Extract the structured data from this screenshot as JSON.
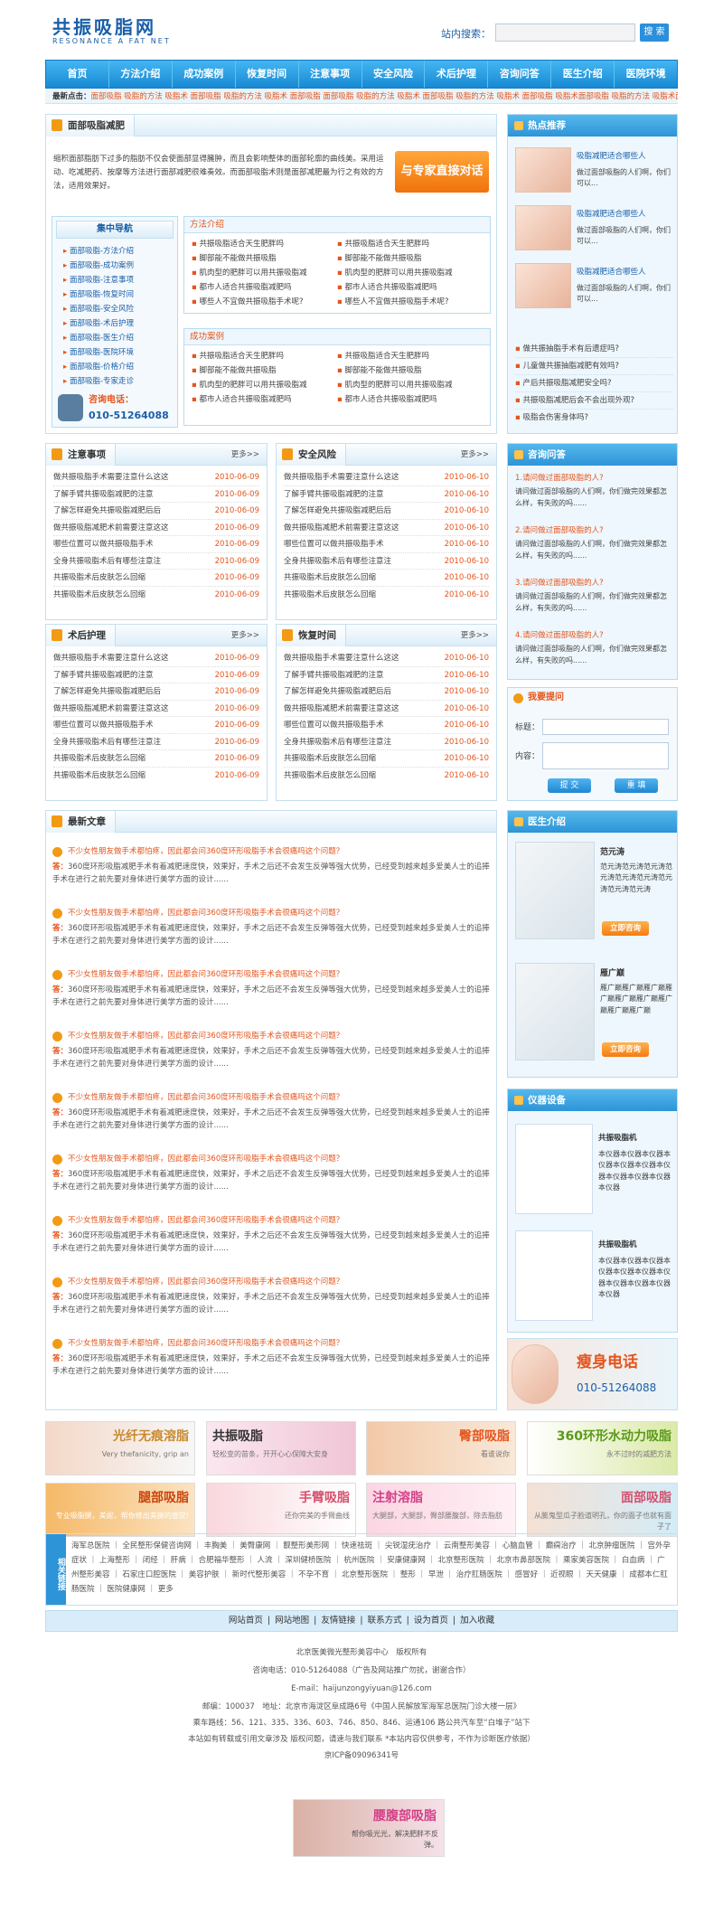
{
  "header": {
    "logo": "共振吸脂网",
    "logo_en": "RESONANCE A FAT NET",
    "search_label": "站内搜索：",
    "search_button": "搜 索"
  },
  "nav": [
    "首页",
    "方法介绍",
    "成功案例",
    "恢复时间",
    "注意事项",
    "安全风险",
    "术后护理",
    "咨询问答",
    "医生介绍",
    "医院环境"
  ],
  "hot": {
    "label": "最新点击：",
    "text": "面部吸脂 吸脂的方法 吸脂术 面部吸脂 吸脂的方法 吸脂术 面部吸脂 面部吸脂 吸脂的方法 吸脂术 面部吸脂 吸脂的方法 吸脂术 面部吸脂 吸脂术面部吸脂 吸脂的方法 吸脂术面部吸脂"
  },
  "intro": {
    "title": "面部吸脂减肥",
    "text": "缩积面部脂肪下过多的脂肪不仅会使面部显得臃肿，而且会影响整体的面部轮廓的曲线美。采用运动、吃减肥药、按摩等方法进行面部减肥很难奏效。而面部吸脂术则是面部减肥最为行之有效的方法，适用效果好。",
    "expert": "与专家直接对话"
  },
  "guide": {
    "title": "集中导航",
    "items": [
      "面部吸脂-方法介绍",
      "面部吸脂-成功案例",
      "面部吸脂-注意事项",
      "面部吸脂-恢复时间",
      "面部吸脂-安全风险",
      "面部吸脂-术后护理",
      "面部吸脂-医生介绍",
      "面部吸脂-医院环境",
      "面部吸脂-价格介绍",
      "面部吸脂-专家走诊"
    ],
    "phone_label": "咨询电话：",
    "phone": "010-51264088"
  },
  "methods": {
    "title": "方法介绍",
    "items": [
      "共振吸脂适合天生肥胖吗",
      "共振吸脂适合天生肥胖吗",
      "脚部能不能做共振吸脂",
      "脚部能不能做共振吸脂",
      "肌肉型的肥胖可以用共振吸脂减",
      "肌肉型的肥胖可以用共振吸脂减",
      "都市人适合共振吸脂减肥吗",
      "都市人适合共振吸脂减肥吗",
      "哪些人不宜做共振吸脂手术呢?",
      "哪些人不宜做共振吸脂手术呢?"
    ]
  },
  "cases": {
    "title": "成功案例",
    "items": [
      "共振吸脂适合天生肥胖吗",
      "共振吸脂适合天生肥胖吗",
      "脚部能不能做共振吸脂",
      "脚部能不能做共振吸脂",
      "肌肉型的肥胖可以用共振吸脂减",
      "肌肉型的肥胖可以用共振吸脂减",
      "都市人适合共振吸脂减肥吗",
      "都市人适合共振吸脂减肥吗"
    ]
  },
  "hot_recommend": {
    "title": "热点推荐",
    "items": [
      {
        "t": "吸脂减肥适合哪些人",
        "d": "做过面部吸脂的人们啊，你们可以..."
      },
      {
        "t": "吸脂减肥适合哪些人",
        "d": "做过面部吸脂的人们啊，你们可以..."
      },
      {
        "t": "吸脂减肥适合哪些人",
        "d": "做过面部吸脂的人们啊，你们可以..."
      }
    ],
    "links": [
      "做共振抽脂手术有后遗症吗?",
      "儿童做共振抽脂减肥有效吗?",
      "产后共振吸脂减肥安全吗?",
      "共振吸脂减肥后会不会出现外观?",
      "吸脂会伤害身体吗?"
    ]
  },
  "more": "更多>>",
  "notes": {
    "title": "注意事项",
    "items": [
      [
        "做共振吸脂手术需要注意什么这这",
        "2010-06-09"
      ],
      [
        "了解手臂共振吸脂减肥的注意",
        "2010-06-09"
      ],
      [
        "了解怎样避免共振吸脂减肥后后",
        "2010-06-09"
      ],
      [
        "做共振吸脂减肥术前需要注意这这",
        "2010-06-09"
      ],
      [
        "哪些位置可以做共振吸脂手术",
        "2010-06-09"
      ],
      [
        "全身共振吸脂术后有哪些注意注",
        "2010-06-09"
      ],
      [
        "共振吸脂术后皮肤怎么回缩",
        "2010-06-09"
      ],
      [
        "共振吸脂术后皮肤怎么回缩",
        "2010-06-09"
      ]
    ]
  },
  "safety": {
    "title": "安全风险",
    "items": [
      [
        "做共振吸脂手术需要注意什么这这",
        "2010-06-10"
      ],
      [
        "了解手臂共振吸脂减肥的注意",
        "2010-06-10"
      ],
      [
        "了解怎样避免共振吸脂减肥后后",
        "2010-06-10"
      ],
      [
        "做共振吸脂减肥术前需要注意这这",
        "2010-06-10"
      ],
      [
        "哪些位置可以做共振吸脂手术",
        "2010-06-10"
      ],
      [
        "全身共振吸脂术后有哪些注意注",
        "2010-06-10"
      ],
      [
        "共振吸脂术后皮肤怎么回缩",
        "2010-06-10"
      ],
      [
        "共振吸脂术后皮肤怎么回缩",
        "2010-06-10"
      ]
    ]
  },
  "aftercare": {
    "title": "术后护理",
    "items": [
      [
        "做共振吸脂手术需要注意什么这这",
        "2010-06-09"
      ],
      [
        "了解手臂共振吸脂减肥的注意",
        "2010-06-09"
      ],
      [
        "了解怎样避免共振吸脂减肥后后",
        "2010-06-09"
      ],
      [
        "做共振吸脂减肥术前需要注意这这",
        "2010-06-09"
      ],
      [
        "哪些位置可以做共振吸脂手术",
        "2010-06-09"
      ],
      [
        "全身共振吸脂术后有哪些注意注",
        "2010-06-09"
      ],
      [
        "共振吸脂术后皮肤怎么回缩",
        "2010-06-09"
      ],
      [
        "共振吸脂术后皮肤怎么回缩",
        "2010-06-09"
      ]
    ]
  },
  "recovery": {
    "title": "恢复时间",
    "items": [
      [
        "做共振吸脂手术需要注意什么这这",
        "2010-06-10"
      ],
      [
        "了解手臂共振吸脂减肥的注意",
        "2010-06-10"
      ],
      [
        "了解怎样避免共振吸脂减肥后后",
        "2010-06-10"
      ],
      [
        "做共振吸脂减肥术前需要注意这这",
        "2010-06-10"
      ],
      [
        "哪些位置可以做共振吸脂手术",
        "2010-06-10"
      ],
      [
        "全身共振吸脂术后有哪些注意注",
        "2010-06-10"
      ],
      [
        "共振吸脂术后皮肤怎么回缩",
        "2010-06-10"
      ],
      [
        "共振吸脂术后皮肤怎么回缩",
        "2010-06-10"
      ]
    ]
  },
  "consult": {
    "title": "咨询问答",
    "items": [
      {
        "q": "1.请问做过面部吸脂的人?",
        "a": "请问做过面部吸脂的人们啊，你们做完效果都怎么样，有失败的吗......"
      },
      {
        "q": "2.请问做过面部吸脂的人?",
        "a": "请问做过面部吸脂的人们啊，你们做完效果都怎么样，有失败的吗......"
      },
      {
        "q": "3.请问做过面部吸脂的人?",
        "a": "请问做过面部吸脂的人们啊，你们做完效果都怎么样，有失败的吗......"
      },
      {
        "q": "4.请问做过面部吸脂的人?",
        "a": "请问做过面部吸脂的人们啊，你们做完效果都怎么样，有失败的吗......"
      }
    ]
  },
  "ask": {
    "title": "我要提问",
    "label_title": "标题：",
    "label_content": "内容：",
    "submit": "提 交",
    "reset": "重 填"
  },
  "latest": {
    "title": "最新文章",
    "q": "不少女性朋友做手术都怕疼，因此都会问360度环形吸脂手术会很痛吗这个问题？",
    "a_label": "答：",
    "a": "360度环形吸脂减肥手术有着减肥速度快，效果好，手术之后还不会发生反弹等强大优势，已经受到越来越多爱美人士的追捧手术在进行之前先要对身体进行美学方面的设计......"
  },
  "doctors": {
    "title": "医生介绍",
    "items": [
      {
        "name": "范元涛",
        "text": "范元涛范元涛范元涛范元涛范元涛范元涛范元涛范元涛范元涛",
        "btn": "立即咨询"
      },
      {
        "name": "雁广巅",
        "text": "雁广巅雁广巅雁广巅雁广巅雁广巅雁广巅雁广巅雁广巅雁广巅",
        "btn": "立即咨询"
      }
    ]
  },
  "devices": {
    "title": "仪器设备",
    "items": [
      {
        "name": "共振吸脂机",
        "text": "本仪器本仪器本仪器本仪器本仪器本仪器本仪器本仪器本仪器本仪器本仪器"
      },
      {
        "name": "共振吸脂机",
        "text": "本仪器本仪器本仪器本仪器本仪器本仪器本仪器本仪器本仪器本仪器本仪器"
      }
    ]
  },
  "slim_phone": {
    "title": "瘦身电话",
    "number": "010-51264088"
  },
  "banners": [
    {
      "t": "光纤无痕溶脂",
      "s": "Very thefanicity, grip an"
    },
    {
      "t": "共振吸脂",
      "s": "轻松变的苗条，开开心心保障大安身"
    },
    {
      "t": "臀部吸脂",
      "s": "看谁说你",
      "e": "臀"
    },
    {
      "t": "360环形水动力吸脂",
      "s": "永不过时的减肥方法"
    },
    {
      "t": "腿部吸脂",
      "s": "专业吸脂腿，美妮，帮你修出美腿的感觉!"
    },
    {
      "t": "手臂吸脂",
      "s": "还你完美的手臂曲线"
    },
    {
      "t": "注射溶脂",
      "s": "大腿部，大腿部，臀部腰腹部，除去脂肪"
    },
    {
      "t": "面部吸脂",
      "s": "从膨鬼型瓜子脸道明孔，你的面子也就有面子了"
    }
  ],
  "links": {
    "title": "相关链接",
    "text": "海军总医院 ｜ 全民整形保健咨询网 ｜ 丰胸美 ｜ 美臀康网 ｜ 靓整形美形网 ｜ 快速祛斑 ｜ 尖锐湿疣治疗 ｜ 云南整形美容 ｜ 心脑血管 ｜ 癫痫治疗 ｜ 北京肿瘤医院 ｜ 宫外孕症状 ｜ 上海整形 ｜ 闭经 ｜ 肝病 ｜ 合肥福华整形 ｜ 人流 ｜ 深圳健桥医院 ｜ 杭州医院 ｜ 安康健康网 ｜ 北京整形医院 ｜ 北京市鼻部医院 ｜ 乘家美容医院 ｜ 白血病 ｜ 广州整形美容 ｜ 石家庄口腔医院 ｜ 美容护肤 ｜ 新时代整形美容 ｜ 不孕不育 ｜ 北京整形医院 ｜ 整形 ｜ 早泄 ｜ 治疗肛肠医院 ｜ 感冒好 ｜ 近视眼 ｜ 天天健康 ｜ 成都本仁肛肠医院 ｜ 医院健康网 ｜ 更多"
  },
  "footer_nav": [
    "网站首页",
    "网站地图",
    "友情链接",
    "联系方式",
    "设为首页",
    "加入收藏"
  ],
  "footer": [
    "北京医美微光整形美容中心　版权所有",
    "咨询电话：010-51264088（广告及网站推广勿扰，谢谢合作）",
    "E-mail：haijunzongyiyuan@126.com",
    "邮编：100037　地址：北京市海淀区阜成路6号《中国人民解放军海军总医院门诊大楼一层》",
    "乘车路线：56、121、335、336、603、746、850、846、运通106 路公共汽车至“白堆子”站下",
    "本站如有转载或引用文章涉及 版权问题，请速与我们联系 *本站内容仅供参考，不作为诊断医疗依据）",
    "京ICP备09096341号"
  ],
  "bottom_banner": {
    "t": "腰腹部吸脂",
    "s": "帮你吸光光，解决肥胖不反弹。"
  }
}
